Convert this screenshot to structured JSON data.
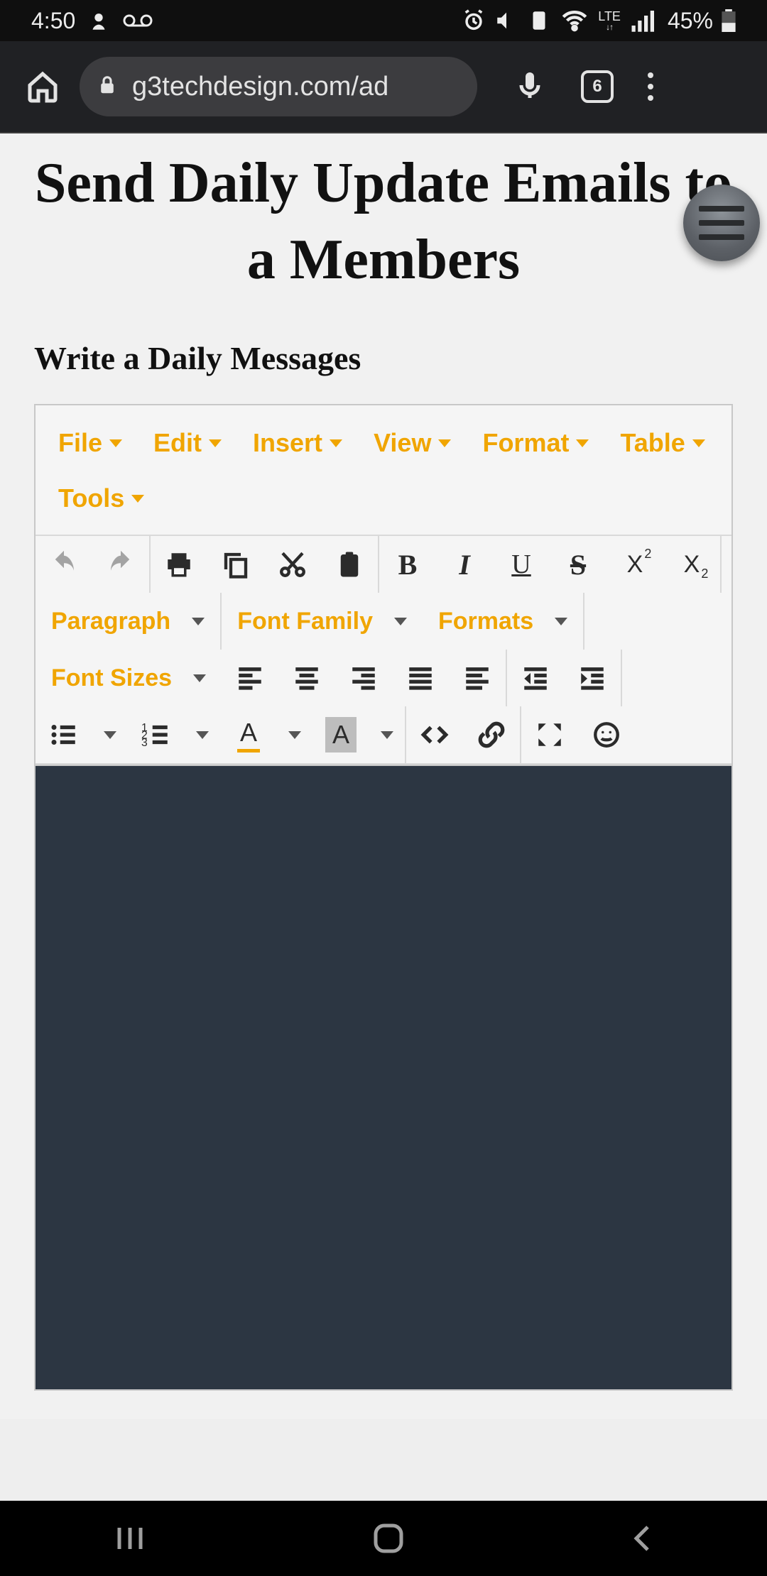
{
  "status": {
    "time": "4:50",
    "battery_pct": "45%",
    "network_label": "LTE"
  },
  "chrome": {
    "url": "g3techdesign.com/ad",
    "tab_count": "6"
  },
  "page": {
    "title": "Send Daily Update Emails to a Members",
    "subhead": "Write a Daily Messages"
  },
  "editor": {
    "menus": {
      "file": "File",
      "edit": "Edit",
      "insert": "Insert",
      "view": "View",
      "format": "Format",
      "table": "Table",
      "tools": "Tools"
    },
    "dropdowns": {
      "block": "Paragraph",
      "font_family": "Font Family",
      "formats": "Formats",
      "font_sizes": "Font Sizes"
    },
    "letters": {
      "bold": "B",
      "italic": "I",
      "underline": "U",
      "strike": "S",
      "sup_base": "X",
      "sub_base": "X",
      "textcolor": "A",
      "bgcolor": "A"
    }
  }
}
